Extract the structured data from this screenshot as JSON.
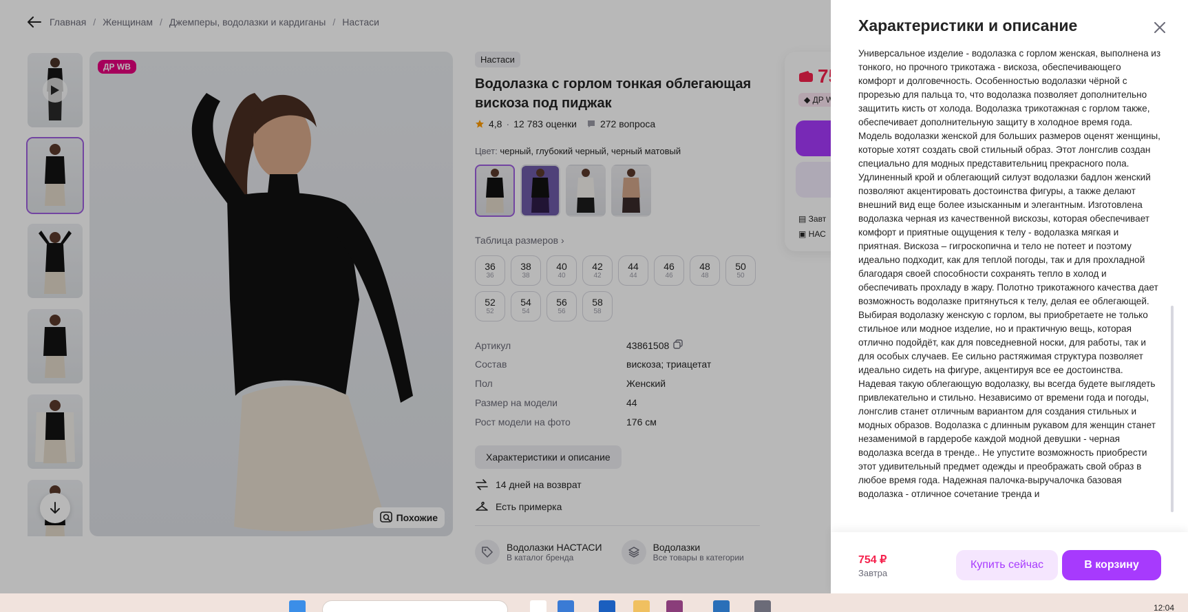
{
  "breadcrumbs": [
    "Главная",
    "Женщинам",
    "Джемперы, водолазки и кардиганы",
    "Настаси"
  ],
  "product": {
    "badge": "ДР WB",
    "similar_label": "Похожие",
    "brand": "Настаси",
    "title": "Водолазка с горлом тонкая облегающая вискоза под пиджак",
    "rating": "4,8",
    "reviews": "12 783 оценки",
    "questions": "272 вопроса",
    "color_label": "Цвет:",
    "color_value": "черный, глубокий черный, черный матовый",
    "size_table_label": "Таблица размеров",
    "sizes": [
      {
        "n": "36",
        "s": "36"
      },
      {
        "n": "38",
        "s": "38"
      },
      {
        "n": "40",
        "s": "40"
      },
      {
        "n": "42",
        "s": "42"
      },
      {
        "n": "44",
        "s": "44"
      },
      {
        "n": "46",
        "s": "46"
      },
      {
        "n": "48",
        "s": "48"
      },
      {
        "n": "50",
        "s": "50"
      },
      {
        "n": "52",
        "s": "52"
      },
      {
        "n": "54",
        "s": "54"
      },
      {
        "n": "56",
        "s": "56"
      },
      {
        "n": "58",
        "s": "58"
      }
    ],
    "specs": [
      {
        "k": "Артикул",
        "v": "43861508"
      },
      {
        "k": "Состав",
        "v": "вискоза; триацетат"
      },
      {
        "k": "Пол",
        "v": "Женский"
      },
      {
        "k": "Размер на модели",
        "v": "44"
      },
      {
        "k": "Рост модели на фото",
        "v": "176 см"
      }
    ],
    "char_button": "Характеристики и описание",
    "features": [
      "14 дней на возврат",
      "Есть примерка"
    ],
    "links": [
      {
        "title": "Водолазки НАСТАСИ",
        "sub": "В каталог бренда"
      },
      {
        "title": "Водолазки",
        "sub": "Все товары в категории"
      }
    ],
    "card_price_partial": "75",
    "card_badge_partial": "ДР W",
    "card_line1": "Завт",
    "card_line2": "НАС"
  },
  "panel": {
    "title": "Характеристики и описание",
    "description": "Универсальное изделие - водолазка с горлом женская, выполнена из тонкого, но прочного трикотажа - вискоза, обеспечивающего комфорт и долговечность. Особенностью водолазки чёрной с прорезью для пальца то, что водолазка позволяет дополнительно защитить кисть от холода. Водолазка трикотажная с горлом также, обеспечивает дополнительную защиту в холодное время года. Модель водолазки женской для больших размеров оценят женщины, которые хотят создать свой стильный образ. Этот лонгслив создан специально для модных представительниц прекрасного пола. Удлиненный крой и облегающий силуэт водолазки бадлон женский позволяют акцентировать достоинства фигуры, а также делают внешний вид еще более изысканным и элегантным. Изготовлена водолазка черная из качественной вискозы, которая обеспечивает комфорт и приятные ощущения к телу - водолазка мягкая и приятная. Вискоза – гигроскопична и тело не потеет и поэтому идеально подходит, как для теплой погоды, так и для прохладной благодаря своей способности сохранять тепло в холод и обеспечивать прохладу в жару. Полотно трикотажного качества дает возможность водолазке притянуться к телу, делая ее облегающей. Выбирая водолазку женскую с горлом, вы приобретаете не только стильное или модное изделие, но и практичную вещь, которая отлично подойдёт, как для повседневной носки, для работы, так и для особых случаев. Ее сильно растяжимая структура позволяет идеально сидеть на фигуре, акцентируя все ее достоинства. Надевая такую облегающую водолазку, вы всегда будете выглядеть привлекательно и стильно. Независимо от времени года и погоды, лонгслив станет отличным вариантом для создания стильных и модных образов. Водолазка с длинным рукавом для женщин станет незаменимой в гардеробе каждой модной девушки - черная водолазка всегда в тренде.. Не упустите возможность приобрести этот удивительный предмет одежды и преображать свой образ в любое время года. Надежная палочка-выручалочка базовая водолазка - отличное сочетание тренда и",
    "price": "754 ₽",
    "delivery": "Завтра",
    "buy_now": "Купить сейчас",
    "to_cart": "В корзину"
  },
  "taskbar": {
    "time": "12:04"
  },
  "colors": {
    "accent": "#a73afd",
    "price": "#f5224d",
    "badge": "#e6007e"
  }
}
